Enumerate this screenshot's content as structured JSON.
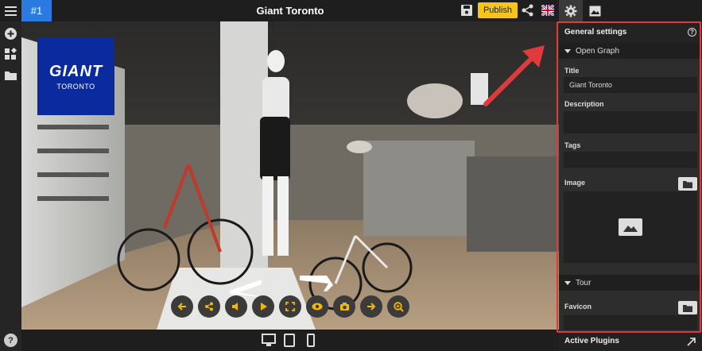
{
  "header": {
    "tab_id": "#1",
    "title": "Giant Toronto",
    "publish_label": "Publish"
  },
  "logo": {
    "brand": "GIANT",
    "city": "TORONTO"
  },
  "panel": {
    "title": "General settings",
    "help_glyph": "?",
    "open_graph": {
      "section_label": "Open Graph",
      "title_label": "Title",
      "title_value": "Giant Toronto",
      "description_label": "Description",
      "description_value": "",
      "tags_label": "Tags",
      "tags_value": "",
      "image_label": "Image"
    },
    "tour": {
      "section_label": "Tour",
      "favicon_label": "Favicon",
      "favicon_value": ""
    },
    "active_plugins_label": "Active Plugins"
  },
  "bottom": {
    "help_glyph": "?"
  },
  "viewer_controls": [
    "arrow-left-icon",
    "share-icon",
    "volume-icon",
    "play-icon",
    "fullscreen-icon",
    "eye-icon",
    "camera-icon",
    "arrow-right-icon",
    "zoom-icon"
  ],
  "colors": {
    "accent": "#2a7ae2",
    "publish": "#f5c518",
    "highlight": "#e03a3a",
    "logo_bg": "#0b2a9e",
    "control_icon": "#f5b800"
  }
}
